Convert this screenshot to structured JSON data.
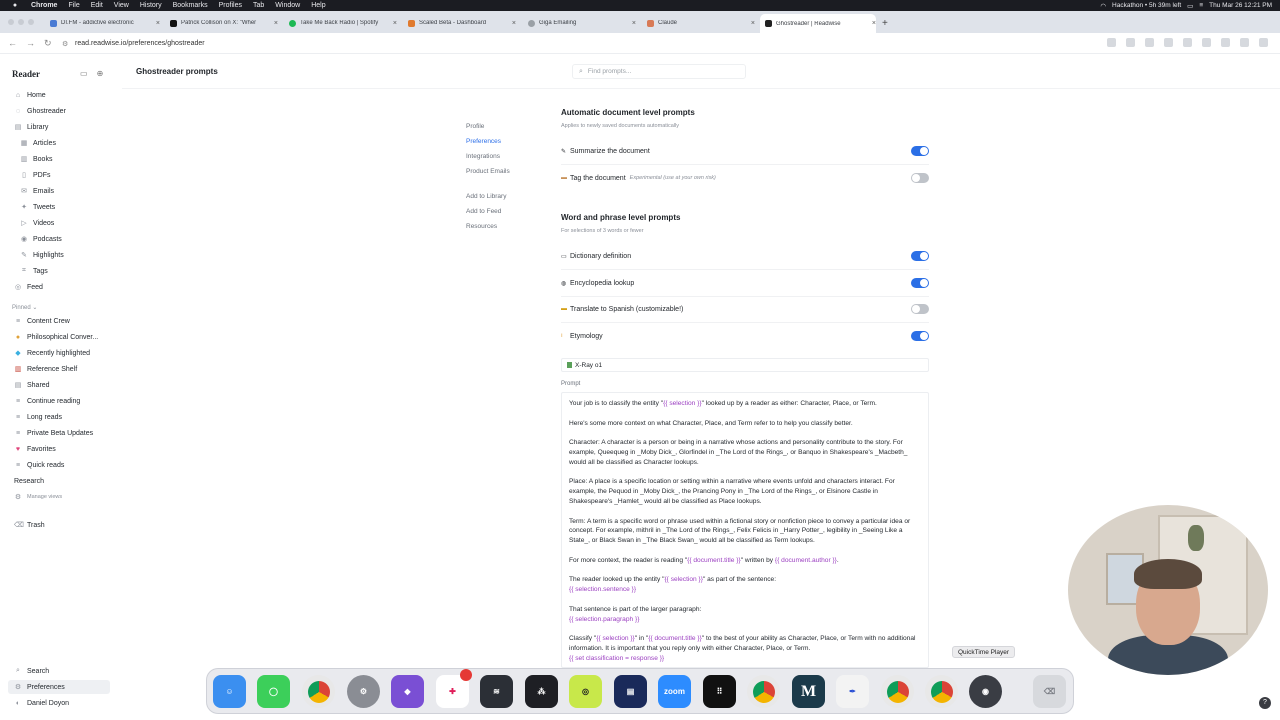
{
  "menubar": {
    "items": [
      "Chrome",
      "File",
      "Edit",
      "View",
      "History",
      "Bookmarks",
      "Profiles",
      "Tab",
      "Window",
      "Help"
    ],
    "status_pill": "Hackathon • 5h 39m left",
    "datetime": "Thu Mar 26  12:21 PM"
  },
  "tabs": [
    {
      "title": "DI.FM - addictive electronic",
      "color": "#4a7bd4"
    },
    {
      "title": "Patrick Collison on X: \"Wher",
      "color": "#111111"
    },
    {
      "title": "Take Me Back Radio | Spotify",
      "color": "#1db954"
    },
    {
      "title": "Scaled Beta - Dashboard",
      "color": "#e07a2e"
    },
    {
      "title": "Giga Emailing",
      "color": "#9aa0a6"
    },
    {
      "title": "Claude",
      "color": "#d87a56"
    },
    {
      "title": "Ghostreader | Readwise",
      "color": "#222222"
    }
  ],
  "address": {
    "url": "read.readwise.io/preferences/ghostreader"
  },
  "sidebar": {
    "brand": "Reader",
    "items": {
      "home": "Home",
      "ghostreader": "Ghostreader",
      "library": "Library",
      "articles": "Articles",
      "books": "Books",
      "pdfs": "PDFs",
      "emails": "Emails",
      "tweets": "Tweets",
      "videos": "Videos",
      "podcasts": "Podcasts",
      "highlights": "Highlights",
      "tags": "Tags",
      "feed": "Feed"
    },
    "pinned_label": "Pinned ⌄",
    "pinned": {
      "content_crew": "Content Crew",
      "philosophical": "Philosophical Conver...",
      "recently_highlighted": "Recently highlighted",
      "reference_shelf": "Reference Shelf",
      "shared": "Shared",
      "continue_reading": "Continue reading",
      "long_reads": "Long reads",
      "private_beta": "Private Beta Updates",
      "favorites": "Favorites",
      "quick_reads": "Quick reads"
    },
    "research": "Research",
    "manage_views": "Manage views",
    "trash": "Trash",
    "search": "Search",
    "preferences": "Preferences",
    "user": "Daniel Doyon"
  },
  "header": {
    "title": "Ghostreader prompts",
    "search_placeholder": "Find prompts..."
  },
  "settings_nav": {
    "profile": "Profile",
    "preferences": "Preferences",
    "integrations": "Integrations",
    "product_emails": "Product Emails",
    "add_library": "Add to Library",
    "add_feed": "Add to Feed",
    "resources": "Resources"
  },
  "document_prompts": {
    "title": "Automatic document level prompts",
    "subtitle": "Applies to newly saved documents automatically",
    "summarize": "Summarize the document",
    "tag": "Tag the document",
    "tag_note": "Experimental (use at your own risk)"
  },
  "word_prompts": {
    "title": "Word and phrase level prompts",
    "subtitle": "For selections of 3 words or fewer",
    "dictionary": "Dictionary definition",
    "encyclopedia": "Encyclopedia lookup",
    "translate": "Translate to Spanish (customizable!)",
    "etymology": "Etymology"
  },
  "toggles": {
    "summarize": true,
    "tag": false,
    "dictionary": true,
    "encyclopedia": true,
    "translate": false,
    "etymology": true
  },
  "xray": {
    "name": "X-Ray o1",
    "prompt_label": "Prompt"
  },
  "prompt": {
    "p1a": "Your job is to classify the entity \"",
    "sel": "{{ selection }}",
    "p1b": "\" looked up by a reader as either: Character, Place, or Term.",
    "p2": "Here's some more context on what Character, Place, and Term refer to to help you classify better.",
    "p3": "Character: A character is a person or being in a narrative whose actions and personality contribute to the story. For example, Queequeg in _Moby Dick_, Glorfindel in _The Lord of the Rings_, or Banquo in Shakespeare's _Macbeth_ would all be classified as Character lookups.",
    "p4": "Place: A place is a specific location or setting within a narrative where events unfold and characters interact. For example, the Pequod in _Moby Dick_, the Prancing Pony in _The Lord of the Rings_, or Elsinore Castle in Shakespeare's _Hamlet_ would all be classified as Place lookups.",
    "p5": "Term: A term is a specific word or phrase used within a fictional story or nonfiction piece to convey a particular idea or concept. For example, mithril in _The Lord of the Rings_, Felix Felicis in _Harry Potter_, legibility in _Seeing Like a State_, or Black Swan in _The Black Swan_ would all be classified as Term lookups.",
    "p6a": "For more context, the reader is reading \"",
    "doc_title": "{{ document.title }}",
    "p6b": "\" written by ",
    "doc_author": "{{ document.author }}",
    "p6c": ".",
    "p7a": "The reader looked up the entity \"",
    "p7b": "\" as part of the sentence:",
    "sentence": "{{ selection.sentence }}",
    "p8": "That sentence is part of the larger paragraph:",
    "paragraph": "{{ selection.paragraph }}",
    "p9a": "Classify \"",
    "p9b": "\" in \"",
    "p9c": "\" to the best of your ability as Character, Place, or Term with no additional information. It is important that you reply only with either Character, Place, or Term.",
    "p10": "{{ set classification = response }}"
  },
  "dock": {
    "tooltip": "QuickTime Player",
    "zoom_label": "zoom"
  }
}
